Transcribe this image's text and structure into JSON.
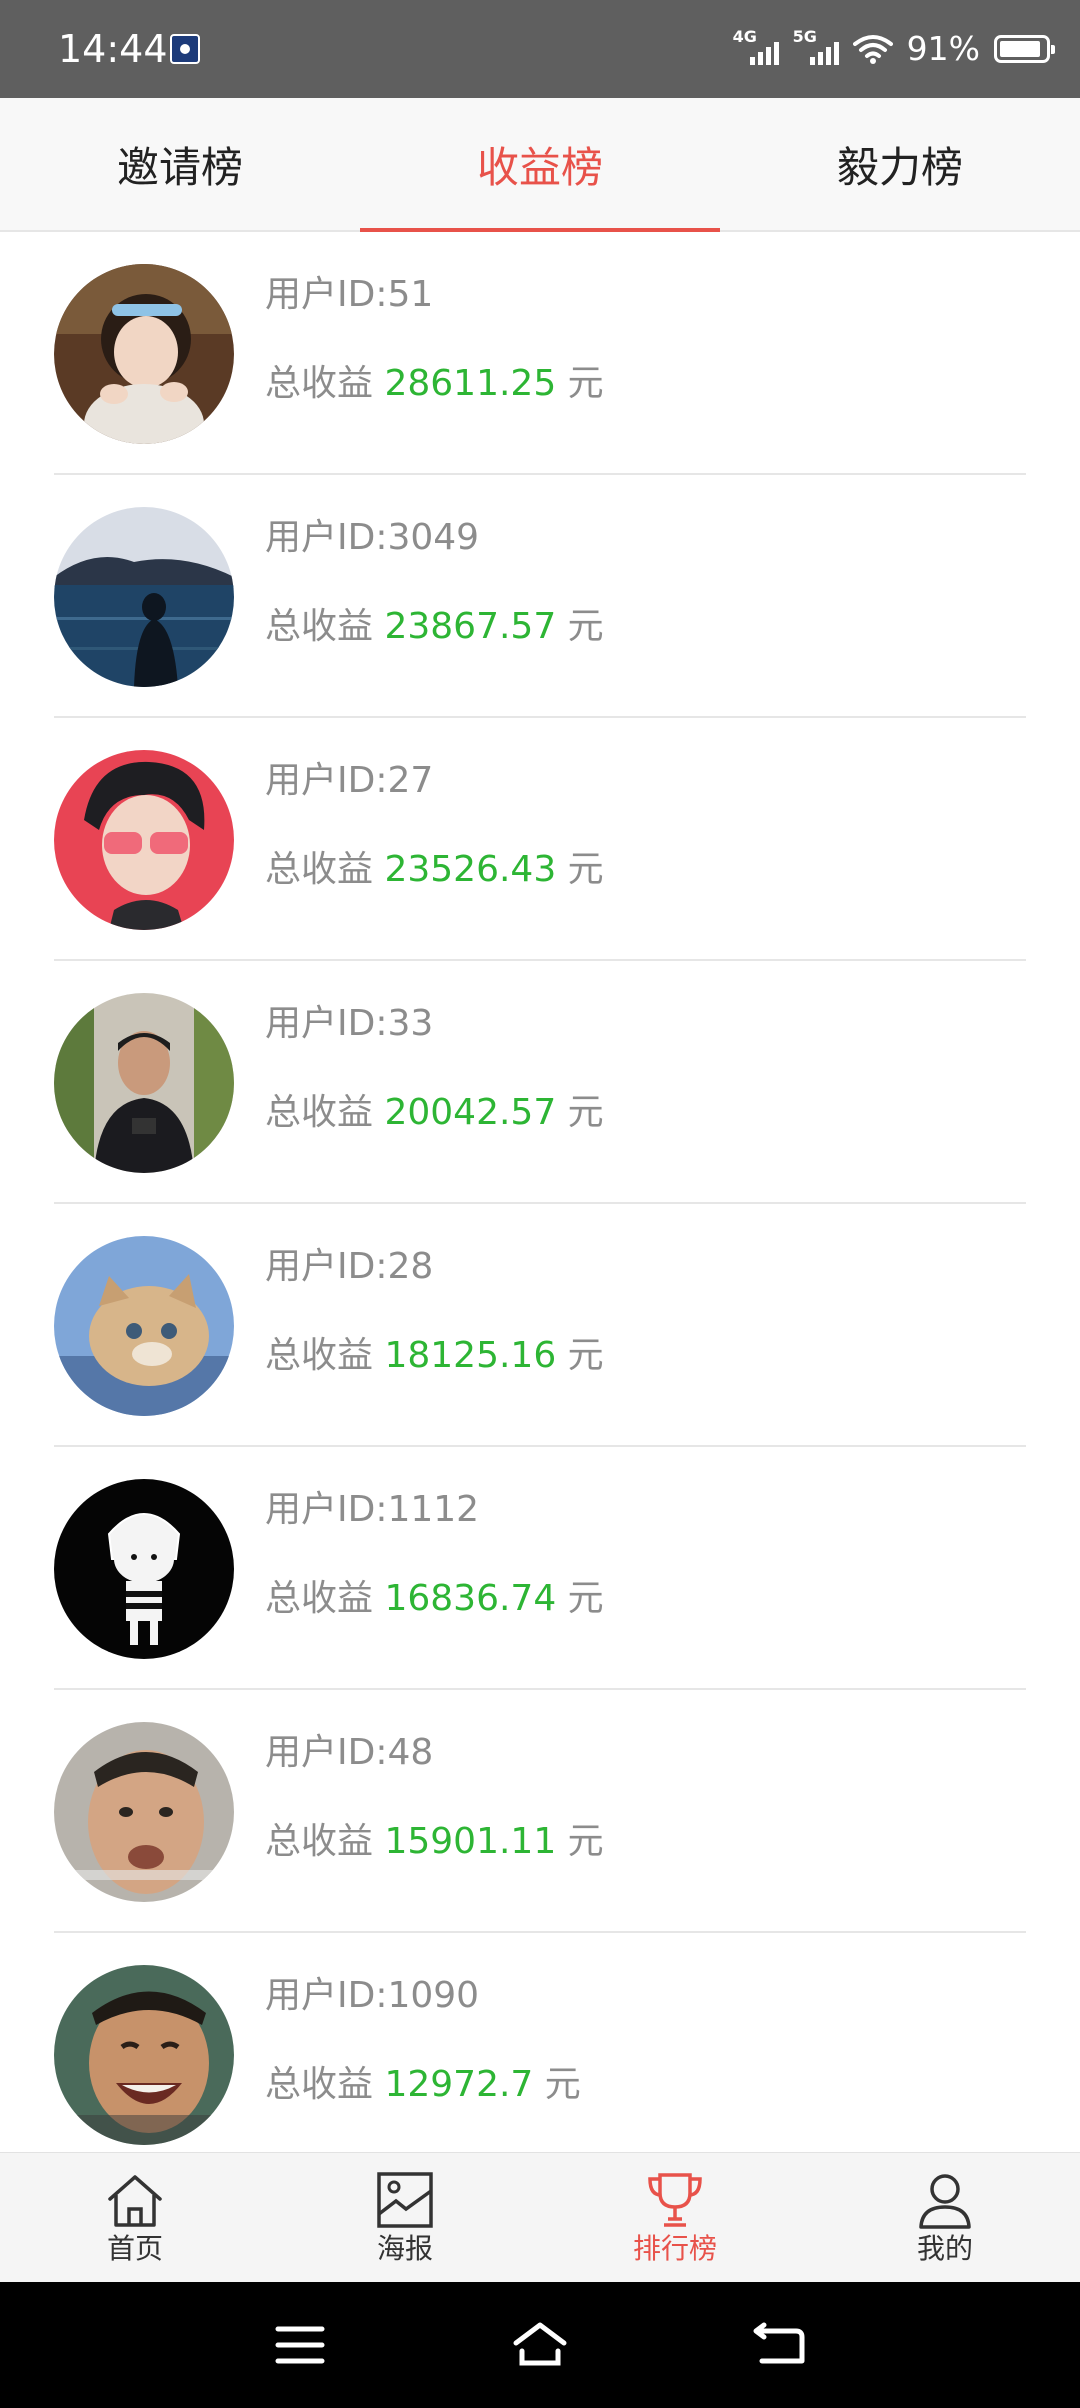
{
  "status_bar": {
    "time": "14:44",
    "net1": "4G",
    "net2": "5G",
    "battery_pct": "91%",
    "battery_level": 0.91
  },
  "tabs": [
    {
      "label": "邀请榜",
      "active": false
    },
    {
      "label": "收益榜",
      "active": true
    },
    {
      "label": "毅力榜",
      "active": false
    }
  ],
  "rows": [
    {
      "uid": "用户ID:51",
      "prefix": "总收益 ",
      "amount": "28611.25",
      "unit": " 元"
    },
    {
      "uid": "用户ID:3049",
      "prefix": "总收益 ",
      "amount": "23867.57",
      "unit": " 元"
    },
    {
      "uid": "用户ID:27",
      "prefix": "总收益 ",
      "amount": "23526.43",
      "unit": " 元"
    },
    {
      "uid": "用户ID:33",
      "prefix": "总收益 ",
      "amount": "20042.57",
      "unit": " 元"
    },
    {
      "uid": "用户ID:28",
      "prefix": "总收益 ",
      "amount": "18125.16",
      "unit": " 元"
    },
    {
      "uid": "用户ID:1112",
      "prefix": "总收益 ",
      "amount": "16836.74",
      "unit": " 元"
    },
    {
      "uid": "用户ID:48",
      "prefix": "总收益 ",
      "amount": "15901.11",
      "unit": " 元"
    },
    {
      "uid": "用户ID:1090",
      "prefix": "总收益 ",
      "amount": "12972.7",
      "unit": " 元"
    }
  ],
  "nav": [
    {
      "label": "首页",
      "icon": "home-icon"
    },
    {
      "label": "海报",
      "icon": "poster-icon"
    },
    {
      "label": "排行榜",
      "icon": "trophy-icon",
      "active": true
    },
    {
      "label": "我的",
      "icon": "user-icon"
    }
  ],
  "colors": {
    "accent": "#e8524a",
    "amount": "#2db534",
    "muted": "#8c8c8c"
  }
}
